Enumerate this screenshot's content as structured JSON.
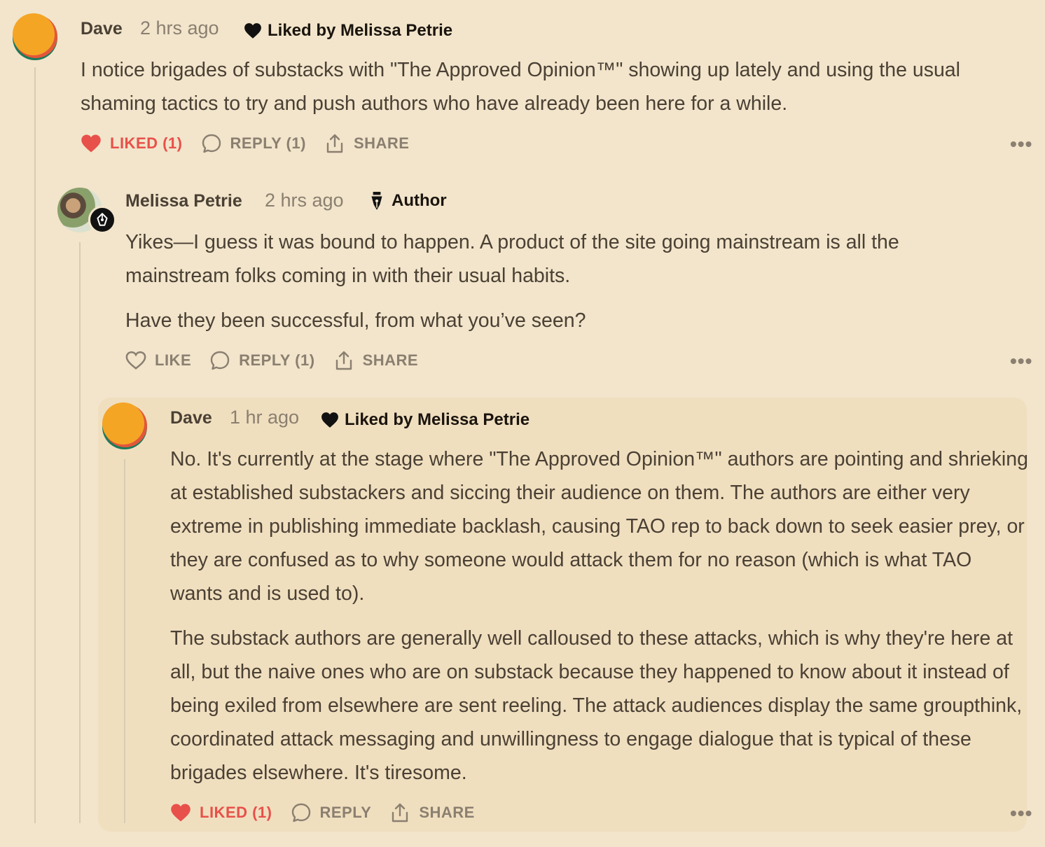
{
  "comments": [
    {
      "author": "Dave",
      "time": "2 hrs ago",
      "liked_by": "Liked by Melissa Petrie",
      "paragraphs": [
        "I notice brigades of substacks with \"The Approved Opinion™\" showing up lately and using the usual shaming tactics to try and push authors who have already been here for a while."
      ],
      "actions": {
        "like": "LIKED (1)",
        "reply": "REPLY (1)",
        "share": "SHARE"
      }
    },
    {
      "author": "Melissa Petrie",
      "time": "2 hrs ago",
      "badge": "Author",
      "paragraphs": [
        "Yikes—I guess it was bound to happen. A product of the site going mainstream is all the mainstream folks coming in with their usual habits.",
        "Have they been successful, from what you’ve seen?"
      ],
      "actions": {
        "like": "LIKE",
        "reply": "REPLY (1)",
        "share": "SHARE"
      }
    },
    {
      "author": "Dave",
      "time": "1 hr ago",
      "liked_by": "Liked by Melissa Petrie",
      "paragraphs": [
        "No. It's currently at the stage where \"The Approved Opinion™\" authors are pointing and shrieking at established substackers and siccing their audience on them. The authors are either very extreme in publishing immediate backlash, causing TAO rep to back down to seek easier prey, or they are confused as to why someone would attack them for no reason (which is what TAO wants and is used to).",
        "The substack authors are generally well calloused to these attacks, which is why they're here at all, but the naive ones who are on substack because they happened to know about it instead of being exiled from elsewhere are sent reeling. The attack audiences display the same groupthink, coordinated attack messaging and unwillingness to engage dialogue that is typical of these brigades elsewhere. It's tiresome."
      ],
      "actions": {
        "like": "LIKED (1)",
        "reply": "REPLY",
        "share": "SHARE"
      }
    }
  ],
  "more_label": "•••",
  "colors": {
    "background": "#f2e5cb",
    "liked": "#e8504a",
    "muted": "#8a7f70",
    "nested_card": "#f0dfbf"
  },
  "icons": {
    "heart": "heart-icon",
    "reply": "speech-bubble-icon",
    "share": "share-icon",
    "more": "ellipsis-icon",
    "author": "pen-nib-icon"
  }
}
